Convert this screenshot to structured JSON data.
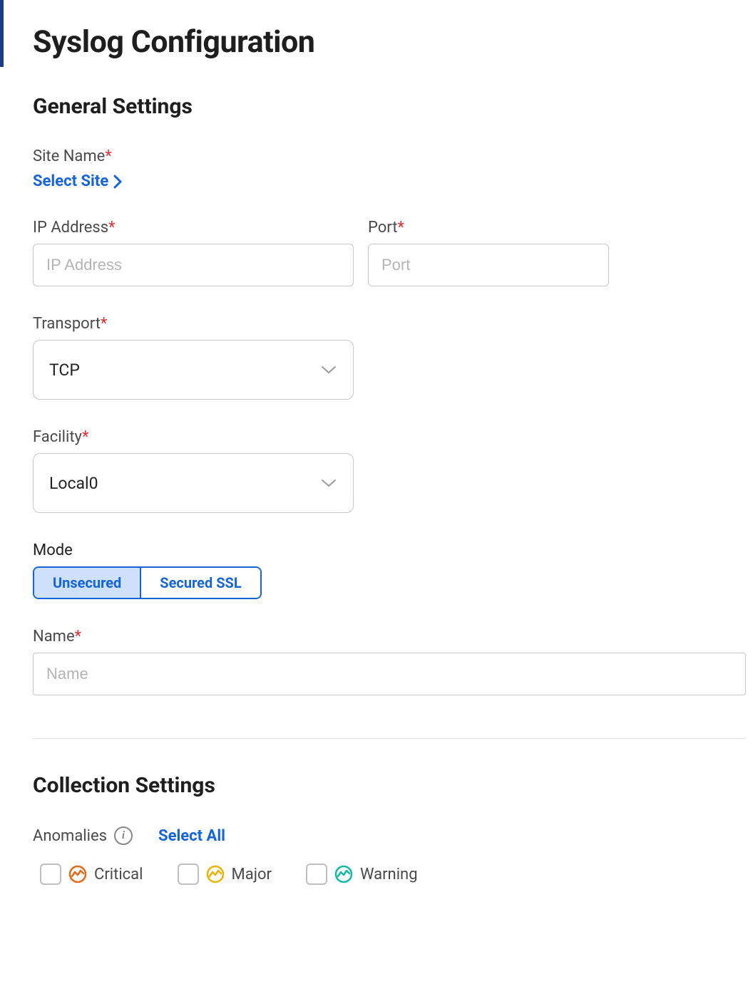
{
  "page_title": "Syslog Configuration",
  "general": {
    "heading": "General Settings",
    "site_name_label": "Site Name",
    "select_site_label": "Select Site",
    "ip_label": "IP Address",
    "ip_placeholder": "IP Address",
    "port_label": "Port",
    "port_placeholder": "Port",
    "transport_label": "Transport",
    "transport_value": "TCP",
    "facility_label": "Facility",
    "facility_value": "Local0",
    "mode_label": "Mode",
    "mode_options": {
      "unsecured": "Unsecured",
      "secured": "Secured SSL"
    },
    "name_label": "Name",
    "name_placeholder": "Name"
  },
  "collection": {
    "heading": "Collection Settings",
    "anomalies_label": "Anomalies",
    "select_all_label": "Select All",
    "severities": {
      "critical": {
        "label": "Critical",
        "color": "#e06a1a"
      },
      "major": {
        "label": "Major",
        "color": "#eab308"
      },
      "warning": {
        "label": "Warning",
        "color": "#14b8a6"
      }
    }
  }
}
